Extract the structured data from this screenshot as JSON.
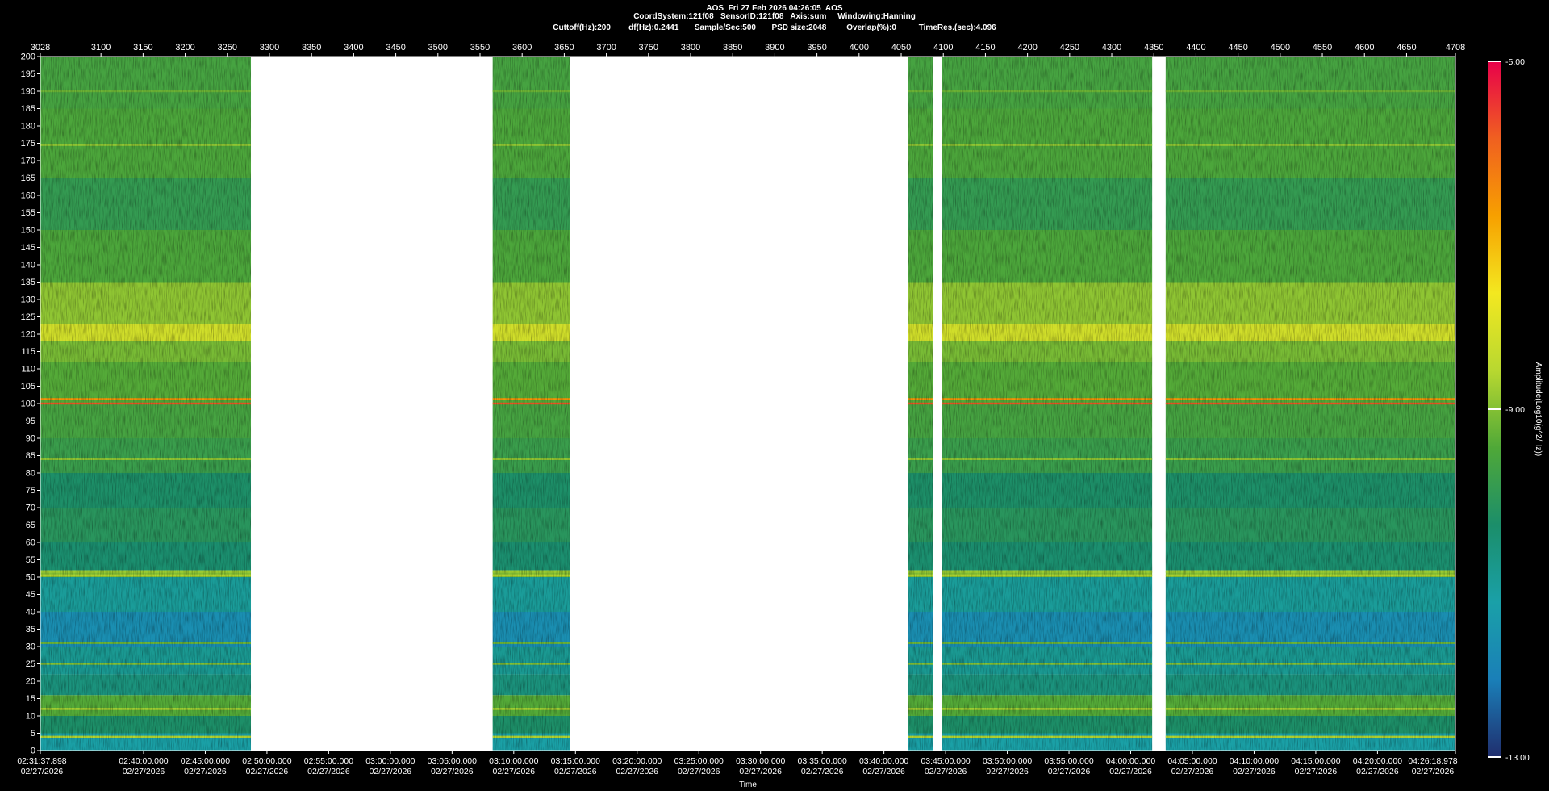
{
  "header": {
    "line1": "AOS  Fri 27 Feb 2026 04:26:05  AOS",
    "line2": "CoordSystem:121f08   SensorID:121f08   Axis:sum     Windowing:Hanning",
    "line3": "Cuttoff(Hz):200        df(Hz):0.2441       Sample/Sec:500       PSD size:2048         Overlap(%):0          TimeRes.(sec):4.096"
  },
  "chart_data": {
    "type": "heatmap",
    "title": "AOS  Fri 27 Feb 2026 04:26:05  AOS",
    "ylim": [
      0,
      200
    ],
    "y_ticks": [
      0,
      5,
      10,
      15,
      20,
      25,
      30,
      35,
      40,
      45,
      50,
      55,
      60,
      65,
      70,
      75,
      80,
      85,
      90,
      95,
      100,
      105,
      110,
      115,
      120,
      125,
      130,
      135,
      140,
      145,
      150,
      155,
      160,
      165,
      170,
      175,
      180,
      185,
      190,
      195,
      200
    ],
    "top_axis": {
      "range": [
        3028,
        4708
      ],
      "ticks": [
        3028,
        3100,
        3150,
        3200,
        3250,
        3300,
        3350,
        3400,
        3450,
        3500,
        3550,
        3600,
        3650,
        3700,
        3750,
        3800,
        3850,
        3900,
        3950,
        4000,
        4050,
        4100,
        4150,
        4200,
        4250,
        4300,
        4350,
        4400,
        4450,
        4500,
        4550,
        4600,
        4650,
        4708
      ]
    },
    "x_axis": {
      "start": "2026-02-27 02:31:37.898",
      "end": "2026-02-27 04:26:18.978",
      "xlabel": "Time",
      "ticks": [
        {
          "time": "02:31:37.898",
          "date": "02/27/2026"
        },
        {
          "time": "02:40:00.000",
          "date": "02/27/2026"
        },
        {
          "time": "02:45:00.000",
          "date": "02/27/2026"
        },
        {
          "time": "02:50:00.000",
          "date": "02/27/2026"
        },
        {
          "time": "02:55:00.000",
          "date": "02/27/2026"
        },
        {
          "time": "03:00:00.000",
          "date": "02/27/2026"
        },
        {
          "time": "03:05:00.000",
          "date": "02/27/2026"
        },
        {
          "time": "03:10:00.000",
          "date": "02/27/2026"
        },
        {
          "time": "03:15:00.000",
          "date": "02/27/2026"
        },
        {
          "time": "03:20:00.000",
          "date": "02/27/2026"
        },
        {
          "time": "03:25:00.000",
          "date": "02/27/2026"
        },
        {
          "time": "03:30:00.000",
          "date": "02/27/2026"
        },
        {
          "time": "03:35:00.000",
          "date": "02/27/2026"
        },
        {
          "time": "03:40:00.000",
          "date": "02/27/2026"
        },
        {
          "time": "03:45:00.000",
          "date": "02/27/2026"
        },
        {
          "time": "03:50:00.000",
          "date": "02/27/2026"
        },
        {
          "time": "03:55:00.000",
          "date": "02/27/2026"
        },
        {
          "time": "04:00:00.000",
          "date": "02/27/2026"
        },
        {
          "time": "04:05:00.000",
          "date": "02/27/2026"
        },
        {
          "time": "04:10:00.000",
          "date": "02/27/2026"
        },
        {
          "time": "04:15:00.000",
          "date": "02/27/2026"
        },
        {
          "time": "04:20:00.000",
          "date": "02/27/2026"
        },
        {
          "time": "04:26:18.978",
          "date": "02/27/2026"
        }
      ]
    },
    "data_segments": [
      {
        "from_index": 3028,
        "to_index": 3278
      },
      {
        "from_index": 3565,
        "to_index": 3657
      },
      {
        "from_index": 4058,
        "to_index": 4088
      },
      {
        "from_index": 4098,
        "to_index": 4348
      },
      {
        "from_index": 4364,
        "to_index": 4708
      }
    ],
    "bands_hz": [
      {
        "from": 0,
        "to": 5,
        "level": -11.2
      },
      {
        "from": 5,
        "to": 10,
        "level": -10.3
      },
      {
        "from": 10,
        "to": 16,
        "level": -9.4
      },
      {
        "from": 16,
        "to": 22,
        "level": -10.6
      },
      {
        "from": 22,
        "to": 30,
        "level": -10.9
      },
      {
        "from": 30,
        "to": 40,
        "level": -11.7
      },
      {
        "from": 40,
        "to": 50,
        "level": -11.0
      },
      {
        "from": 50,
        "to": 52,
        "level": -9.0
      },
      {
        "from": 52,
        "to": 60,
        "level": -10.4
      },
      {
        "from": 60,
        "to": 70,
        "level": -10.1
      },
      {
        "from": 70,
        "to": 80,
        "level": -10.3
      },
      {
        "from": 80,
        "to": 90,
        "level": -9.8
      },
      {
        "from": 90,
        "to": 100,
        "level": -9.6
      },
      {
        "from": 100,
        "to": 112,
        "level": -9.4
      },
      {
        "from": 112,
        "to": 118,
        "level": -9.1
      },
      {
        "from": 118,
        "to": 123,
        "level": -8.2
      },
      {
        "from": 123,
        "to": 135,
        "level": -8.9
      },
      {
        "from": 135,
        "to": 150,
        "level": -9.5
      },
      {
        "from": 150,
        "to": 165,
        "level": -9.9
      },
      {
        "from": 165,
        "to": 185,
        "level": -9.5
      },
      {
        "from": 185,
        "to": 200,
        "level": -9.6
      }
    ],
    "tonal_lines_hz": [
      {
        "freq": 4,
        "level": -8.6
      },
      {
        "freq": 12,
        "level": -8.6
      },
      {
        "freq": 25,
        "level": -9.0
      },
      {
        "freq": 31,
        "level": -9.2
      },
      {
        "freq": 50.5,
        "level": -8.6
      },
      {
        "freq": 51.5,
        "level": -8.8
      },
      {
        "freq": 84,
        "level": -8.9
      },
      {
        "freq": 100,
        "level": -5.8
      },
      {
        "freq": 101.3,
        "level": -6.6
      },
      {
        "freq": 174.5,
        "level": -8.9
      },
      {
        "freq": 190,
        "level": -9.2
      }
    ],
    "colorbar": {
      "label": "Amplitude(Log10(g^2/Hz))",
      "min": -13,
      "max": -5,
      "tick_labels": [
        "-5.00",
        "-9.00",
        "-13.00"
      ],
      "colors": [
        "#e8004a",
        "#f06020",
        "#f7a000",
        "#f3e820",
        "#b8d830",
        "#4fa838",
        "#1b8e6a",
        "#1aa0a8",
        "#1a7fb8",
        "#202e6e"
      ]
    }
  }
}
